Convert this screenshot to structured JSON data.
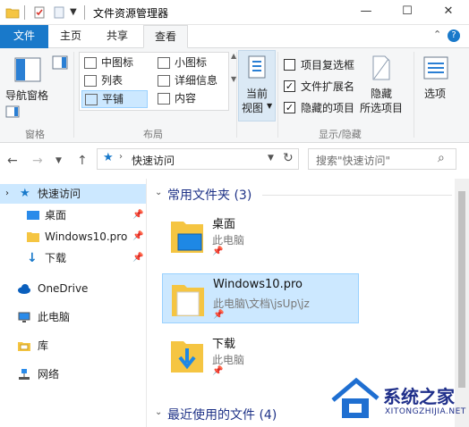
{
  "window": {
    "title": "文件资源管理器",
    "minimize": "—",
    "maximize": "☐",
    "close": "✕"
  },
  "tabs": [
    {
      "label": "文件"
    },
    {
      "label": "主页"
    },
    {
      "label": "共享"
    },
    {
      "label": "查看"
    }
  ],
  "ribbon": {
    "nav_pane": "导航窗格",
    "group_pane": "窗格",
    "layout": {
      "items": [
        "中图标",
        "小图标",
        "列表",
        "详细信息",
        "平铺",
        "内容"
      ],
      "selected": "平铺"
    },
    "group_layout": "布局",
    "current_view": "当前",
    "current_view2": "视图",
    "checks": [
      {
        "label": "项目复选框",
        "checked": false
      },
      {
        "label": "文件扩展名",
        "checked": true
      },
      {
        "label": "隐藏的项目",
        "checked": true
      }
    ],
    "hide_selected": "隐藏",
    "hide_selected2": "所选项目",
    "options": "选项",
    "group_show_hide": "显示/隐藏"
  },
  "address": {
    "path": "快速访问",
    "search_placeholder": "搜索\"快速访问\""
  },
  "nav": {
    "items": [
      {
        "label": "快速访问"
      },
      {
        "label": "桌面"
      },
      {
        "label": "Windows10.pro"
      },
      {
        "label": "下载"
      },
      {
        "label": "OneDrive"
      },
      {
        "label": "此电脑"
      },
      {
        "label": "库"
      },
      {
        "label": "网络"
      }
    ]
  },
  "main": {
    "frequent_title": "常用文件夹 (3)",
    "recent_title": "最近使用的文件 (4)",
    "folders": [
      {
        "name": "桌面",
        "location": "此电脑"
      },
      {
        "name": "Windows10.pro",
        "location": "此电脑\\文档\\jsUp\\jz"
      },
      {
        "name": "下载",
        "location": "此电脑"
      }
    ]
  },
  "watermark": {
    "title": "系统之家",
    "url": "XITONGZHIJIA.NET"
  }
}
